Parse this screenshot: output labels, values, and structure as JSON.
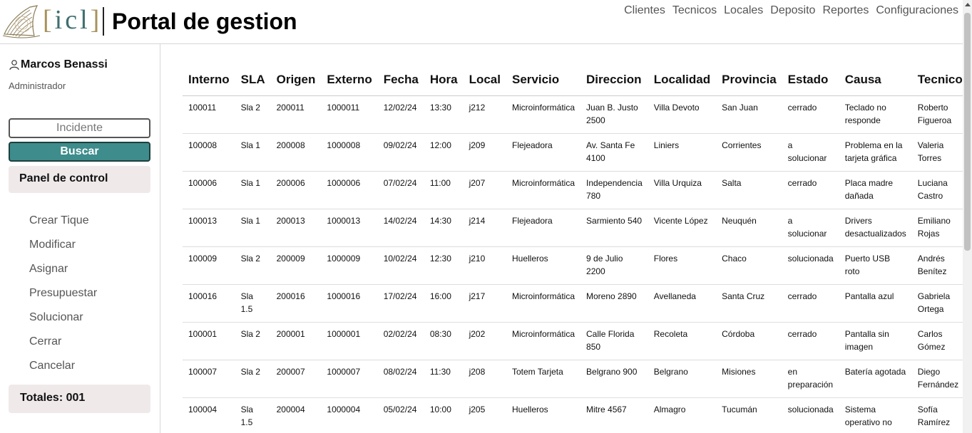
{
  "header": {
    "logo_text_open": "[",
    "logo_text_mid": "icl",
    "logo_text_close": "]",
    "title": "Portal de gestion",
    "nav": [
      "Clientes",
      "Tecnicos",
      "Locales",
      "Deposito",
      "Reportes",
      "Configuraciones"
    ]
  },
  "sidebar": {
    "user_name": "Marcos Benassi",
    "user_role": "Administrador",
    "search_placeholder": "Incidente",
    "search_button": "Buscar",
    "panel_label": "Panel de control",
    "menu": [
      "Crear Tique",
      "Modificar",
      "Asignar",
      "Presupuestar",
      "Solucionar",
      "Cerrar",
      "Cancelar"
    ],
    "totales": "Totales: 001"
  },
  "table": {
    "columns": [
      "Interno",
      "SLA",
      "Origen",
      "Externo",
      "Fecha",
      "Hora",
      "Local",
      "Servicio",
      "Direccion",
      "Localidad",
      "Provincia",
      "Estado",
      "Causa",
      "Tecnico"
    ],
    "rows": [
      [
        "100011",
        "Sla 2",
        "200011",
        "1000011",
        "12/02/24",
        "13:30",
        "j212",
        "Microinformática",
        "Juan B. Justo 2500",
        "Villa Devoto",
        "San Juan",
        "cerrado",
        "Teclado no responde",
        "Roberto Figueroa"
      ],
      [
        "100008",
        "Sla 1",
        "200008",
        "1000008",
        "09/02/24",
        "12:00",
        "j209",
        "Flejeadora",
        "Av. Santa Fe 4100",
        "Liniers",
        "Corrientes",
        "a solucionar",
        "Problema en la tarjeta gráfica",
        "Valeria Torres"
      ],
      [
        "100006",
        "Sla 1",
        "200006",
        "1000006",
        "07/02/24",
        "11:00",
        "j207",
        "Microinformática",
        "Independencia 780",
        "Villa Urquiza",
        "Salta",
        "cerrado",
        "Placa madre dañada",
        "Luciana Castro"
      ],
      [
        "100013",
        "Sla 1",
        "200013",
        "1000013",
        "14/02/24",
        "14:30",
        "j214",
        "Flejeadora",
        "Sarmiento 540",
        "Vicente López",
        "Neuquén",
        "a solucionar",
        "Drivers desactualizados",
        "Emiliano Rojas"
      ],
      [
        "100009",
        "Sla 2",
        "200009",
        "1000009",
        "10/02/24",
        "12:30",
        "j210",
        "Huelleros",
        "9 de Julio 2200",
        "Flores",
        "Chaco",
        "solucionada",
        "Puerto USB roto",
        "Andrés Benítez"
      ],
      [
        "100016",
        "Sla 1.5",
        "200016",
        "1000016",
        "17/02/24",
        "16:00",
        "j217",
        "Microinformática",
        "Moreno 2890",
        "Avellaneda",
        "Santa Cruz",
        "cerrado",
        "Pantalla azul",
        "Gabriela Ortega"
      ],
      [
        "100001",
        "Sla 2",
        "200001",
        "1000001",
        "02/02/24",
        "08:30",
        "j202",
        "Microinformática",
        "Calle Florida 850",
        "Recoleta",
        "Córdoba",
        "cerrado",
        "Pantalla sin imagen",
        "Carlos Gómez"
      ],
      [
        "100007",
        "Sla 2",
        "200007",
        "1000007",
        "08/02/24",
        "11:30",
        "j208",
        "Totem Tarjeta",
        "Belgrano 900",
        "Belgrano",
        "Misiones",
        "en preparación",
        "Batería agotada",
        "Diego Fernández"
      ],
      [
        "100004",
        "Sla 1.5",
        "200004",
        "1000004",
        "05/02/24",
        "10:00",
        "j205",
        "Huelleros",
        "Mitre 4567",
        "Almagro",
        "Tucumán",
        "solucionada",
        "Sistema operativo no",
        "Sofía Ramírez"
      ]
    ]
  },
  "colors": {
    "accent": "#3e8c8c",
    "logo_teal": "#3f6f6e",
    "logo_gold": "#a8925a",
    "panel_bg": "#efe9ea"
  }
}
